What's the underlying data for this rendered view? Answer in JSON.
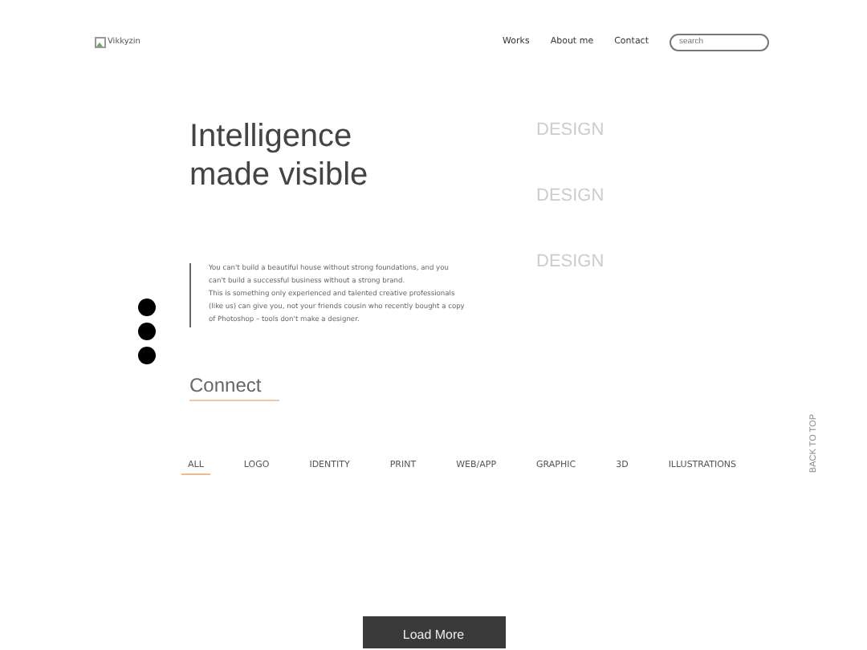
{
  "header": {
    "logo_alt": "Vikkyzin",
    "nav": [
      "Works",
      "About me",
      "Contact"
    ],
    "search": {
      "placeholder": "search"
    }
  },
  "hero": {
    "title_lines": [
      "Intelligence",
      "made visible"
    ],
    "paragraph": "You can't build a beautiful house without strong foundations, and you can't build a successful business without a strong brand.\nThis is something only experienced and talented creative professionals (like us) can give you, not your friends cousin who recently bought a copy of Photoshop – tools don't make a designer.",
    "connect": "Connect",
    "words": [
      "DESIGN",
      "DESIGN",
      "DESIGN"
    ]
  },
  "filters": [
    {
      "label": "ALL",
      "selected": true
    },
    {
      "label": "LOGO",
      "selected": false
    },
    {
      "label": "IDENTITY",
      "selected": false
    },
    {
      "label": "PRINT",
      "selected": false
    },
    {
      "label": "WEB/APP",
      "selected": false
    },
    {
      "label": "GRAPHIC",
      "selected": false
    },
    {
      "label": "3D",
      "selected": false
    },
    {
      "label": "ILLUSTRATIONS",
      "selected": false
    }
  ],
  "back_to_top": "BACK TO TOP",
  "load_more": "Load More"
}
